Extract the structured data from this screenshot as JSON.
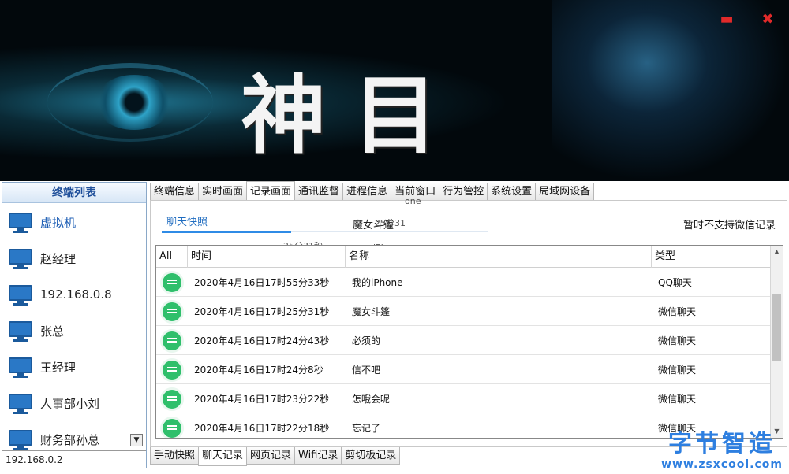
{
  "window": {
    "title": "神目",
    "minimize_icon": "minimize-icon",
    "close_icon": "close-icon",
    "minimize_glyph": "▬",
    "close_glyph": "✖"
  },
  "terminal_panel": {
    "header": "终端列表",
    "items": [
      {
        "label": "虚拟机",
        "icon": "computer-icon"
      },
      {
        "label": "赵经理",
        "icon": "computer-icon"
      },
      {
        "label": "192.168.0.8",
        "icon": "computer-icon"
      },
      {
        "label": "张总",
        "icon": "computer-icon"
      },
      {
        "label": "王经理",
        "icon": "computer-icon"
      },
      {
        "label": "人事部小刘",
        "icon": "computer-icon"
      },
      {
        "label": "财务部孙总",
        "icon": "computer-icon"
      }
    ],
    "scroll_glyph": "▼",
    "current_ip": "192.168.0.2"
  },
  "top_tabs": [
    "终端信息",
    "实时画面",
    "记录画面",
    "通讯监督",
    "进程信息",
    "当前窗口",
    "行为管控",
    "系统设置",
    "局域网设备"
  ],
  "content": {
    "sub_tab": "聊天快照",
    "mid_label": "魔女斗篷",
    "notice": "暂时不支持微信记录",
    "ghost_texts": [
      "25分31",
      "25分31秒",
      "iPhone",
      "one"
    ]
  },
  "grid": {
    "columns": [
      "All",
      "时间",
      "名称",
      "类型"
    ],
    "rows": [
      {
        "icon": "chat-icon",
        "time": "2020年4月16日17时55分33秒",
        "name": "我的iPhone",
        "type": "QQ聊天"
      },
      {
        "icon": "chat-icon",
        "time": "2020年4月16日17时25分31秒",
        "name": "魔女斗篷",
        "type": "微信聊天"
      },
      {
        "icon": "chat-icon",
        "time": "2020年4月16日17时24分43秒",
        "name": "必须的",
        "type": "微信聊天"
      },
      {
        "icon": "chat-icon",
        "time": "2020年4月16日17时24分8秒",
        "name": "信不吧",
        "type": "微信聊天"
      },
      {
        "icon": "chat-icon",
        "time": "2020年4月16日17时23分22秒",
        "name": "怎哦会呢",
        "type": "微信聊天"
      },
      {
        "icon": "chat-icon",
        "time": "2020年4月16日17时22分18秒",
        "name": "忘记了",
        "type": "微信聊天"
      }
    ],
    "scroll_up": "▲",
    "scroll_down": "▼"
  },
  "bottom_tabs": [
    "手动快照",
    "聊天记录",
    "网页记录",
    "Wifi记录",
    "剪切板记录"
  ],
  "watermark": {
    "text": "字节智造",
    "url": "www.zsxcool.com"
  }
}
